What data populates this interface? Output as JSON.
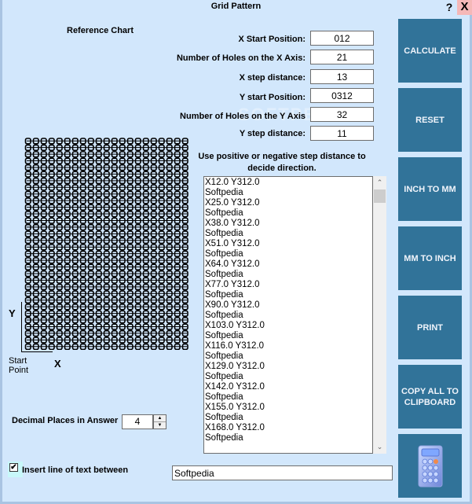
{
  "window": {
    "title": "Grid Pattern",
    "help_label": "?",
    "close_label": "X"
  },
  "reference_chart": {
    "label": "Reference Chart",
    "y_axis_label": "Y",
    "x_axis_label": "X",
    "start_point_label": [
      "Start",
      "Point"
    ],
    "columns": 21,
    "rows": 32,
    "hole_glyph": "0"
  },
  "fields": [
    {
      "label": "X Start Position:",
      "value": "012"
    },
    {
      "label": "Number of Holes on the X Axis:",
      "value": "21"
    },
    {
      "label": "X step distance:",
      "value": "13"
    },
    {
      "label": "Y start Position:",
      "value": "0312"
    },
    {
      "label": "Number of Holes on the Y Axis",
      "value": "32"
    },
    {
      "label": "Y step distance:",
      "value": "11"
    }
  ],
  "hint": "Use positive or negative step distance to decide direction.",
  "output_lines": [
    "X12.0 Y312.0",
    "Softpedia",
    "X25.0 Y312.0",
    "Softpedia",
    "X38.0 Y312.0",
    "Softpedia",
    "X51.0 Y312.0",
    "Softpedia",
    "X64.0 Y312.0",
    "Softpedia",
    "X77.0 Y312.0",
    "Softpedia",
    "X90.0 Y312.0",
    "Softpedia",
    "X103.0 Y312.0",
    "Softpedia",
    "X116.0 Y312.0",
    "Softpedia",
    "X129.0 Y312.0",
    "Softpedia",
    "X142.0 Y312.0",
    "Softpedia",
    "X155.0 Y312.0",
    "Softpedia",
    "X168.0 Y312.0",
    "Softpedia"
  ],
  "scrollbar": {
    "up_icon": "⌃",
    "down_icon": "⌄"
  },
  "buttons": {
    "calculate": "CALCULATE",
    "reset": "RESET",
    "inch_to_mm": "INCH TO MM",
    "mm_to_inch": "MM TO INCH",
    "print": "PRINT",
    "copy_all": "COPY ALL TO CLIPBOARD",
    "calculator_icon": "calculator-icon"
  },
  "decimal_places": {
    "label": "Decimal Places in Answer",
    "value": "4",
    "up": "▲",
    "down": "▼"
  },
  "insert_line": {
    "label": "Insert line of text between",
    "checked": true,
    "check_glyph": "✔",
    "text_value": "Softpedia"
  },
  "colors": {
    "background": "#d2e7fc",
    "button_bg": "#317399",
    "button_text": "#f0f4fb",
    "close_bg": "#f5b8b8"
  }
}
